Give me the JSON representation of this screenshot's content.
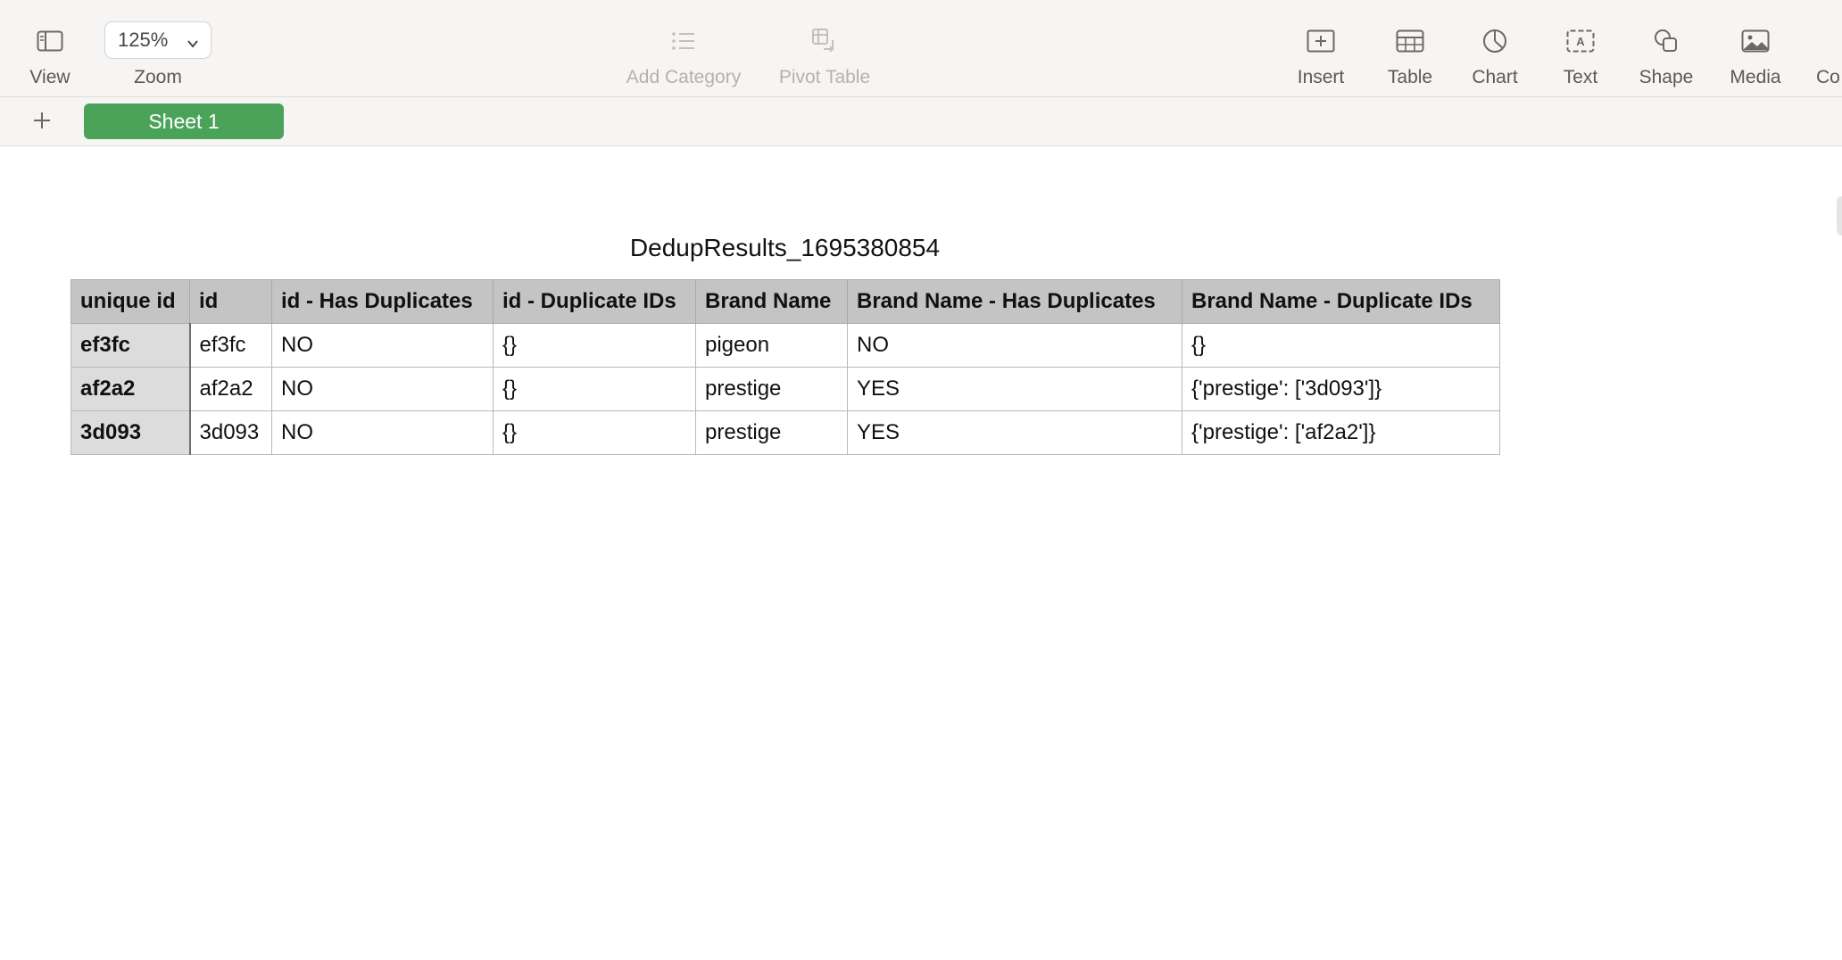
{
  "toolbar": {
    "view_label": "View",
    "zoom_label": "Zoom",
    "zoom_value": "125%",
    "add_category_label": "Add Category",
    "pivot_table_label": "Pivot Table",
    "insert_label": "Insert",
    "table_label": "Table",
    "chart_label": "Chart",
    "text_label": "Text",
    "shape_label": "Shape",
    "media_label": "Media",
    "comment_label": "Co"
  },
  "tabs": {
    "sheets": [
      {
        "label": "Sheet 1",
        "active": true
      }
    ],
    "active_color": "#4ba35a"
  },
  "table": {
    "title": "DedupResults_1695380854",
    "columns": [
      "unique id",
      "id",
      "id - Has Duplicates",
      "id - Duplicate IDs",
      "Brand Name",
      "Brand Name - Has Duplicates",
      "Brand Name - Duplicate IDs"
    ],
    "rows": [
      [
        "ef3fc",
        "ef3fc",
        "NO",
        "{}",
        "pigeon",
        "NO",
        "{}"
      ],
      [
        "af2a2",
        "af2a2",
        "NO",
        "{}",
        "prestige",
        "YES",
        "{'prestige': ['3d093']}"
      ],
      [
        "3d093",
        "3d093",
        "NO",
        "{}",
        "prestige",
        "YES",
        "{'prestige': ['af2a2']}"
      ]
    ]
  }
}
